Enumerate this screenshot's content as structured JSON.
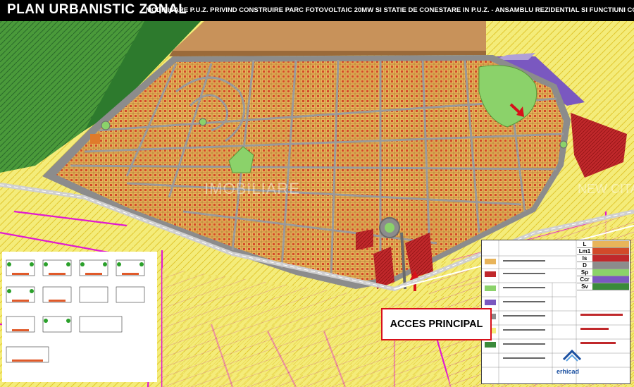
{
  "header": {
    "title": "PLAN URBANISTIC ZONAL",
    "subtitle": "MODIFICARE P.U.Z. PRIVIND CONSTRUIRE PARC FOTOVOLTAIC 20MW SI STATIE DE CONESTARE IN P.U.Z. - ANSAMBLU REZIDENTIAL SI FUNCTIUNI COMPLEMENTARE \"EDEN FOREST\""
  },
  "callout": {
    "label": "ACCES PRINCIPAL"
  },
  "watermarks": {
    "main": "IMOBILIARE",
    "side": "NEW CITA"
  },
  "legend": {
    "zone_keys": [
      "L",
      "Lm1",
      "Is",
      "D",
      "Sp",
      "Ccr",
      "Sv"
    ],
    "logo_text": "erhicad"
  },
  "colors": {
    "background_zone": "#f4ec7a",
    "residential_lot": "#e8b45a",
    "street": "#8c8c8c",
    "green_space": "#8bd26a",
    "forest": "#3a8a3a",
    "red_zone": "#c0282b",
    "purple_zone": "#7a58c0",
    "magenta_line": "#e01ad0",
    "accent": "#d8101a"
  }
}
